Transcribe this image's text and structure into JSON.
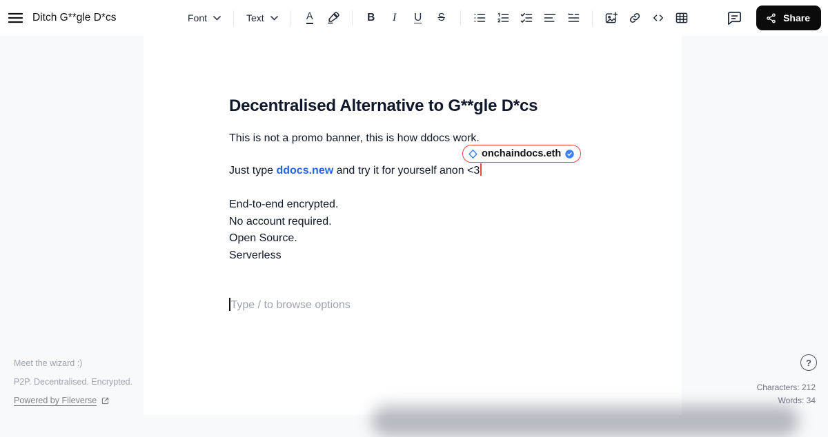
{
  "header": {
    "title": "Ditch G**gle D*cs",
    "font_dropdown_label": "Font",
    "text_dropdown_label": "Text",
    "share_label": "Share"
  },
  "toolbar": {
    "color_glyph": "A",
    "bold_glyph": "B",
    "italic_glyph": "I",
    "underline_glyph": "U",
    "strike_glyph": "S",
    "icons": [
      "text-color",
      "highlight",
      "bold",
      "italic",
      "underline",
      "strikethrough",
      "bullet-list",
      "ordered-list",
      "task-list",
      "align",
      "blockquote",
      "image-add",
      "link",
      "code-block",
      "table",
      "comment",
      "share"
    ]
  },
  "document": {
    "heading": "Decentralised Alternative to G**gle D*cs",
    "paragraph1": "This is not a promo banner, this is how ddocs work.",
    "paragraph2_prefix": "Just type ",
    "paragraph2_link": "ddocs.new",
    "paragraph2_suffix": " and try it for yourself anon <3",
    "features": [
      "End-to-end encrypted.",
      "No account required.",
      "Open Source.",
      "Serverless"
    ],
    "slash_placeholder": "Type  /  to browse options"
  },
  "collaborator": {
    "name": "onchaindocs.eth",
    "cursor_color": "#ef4444",
    "verified_color": "#3b82f6",
    "diamond_color": "#3b82f6"
  },
  "footer_left": {
    "line1": "Meet the wizard :)",
    "line2": "P2P. Decentralised. Encrypted.",
    "link_label": "Powered by Fileverse"
  },
  "footer_right": {
    "characters_label": "Characters:",
    "characters_value": "212",
    "words_label": "Words:",
    "words_value": "34",
    "help_glyph": "?"
  },
  "colors": {
    "background": "#f8f9fb",
    "canvas": "#ffffff",
    "link_blue": "#2563eb",
    "share_button": "#0b0b0c",
    "collab_red": "#ef4444",
    "muted_gray": "#9ca3af"
  }
}
